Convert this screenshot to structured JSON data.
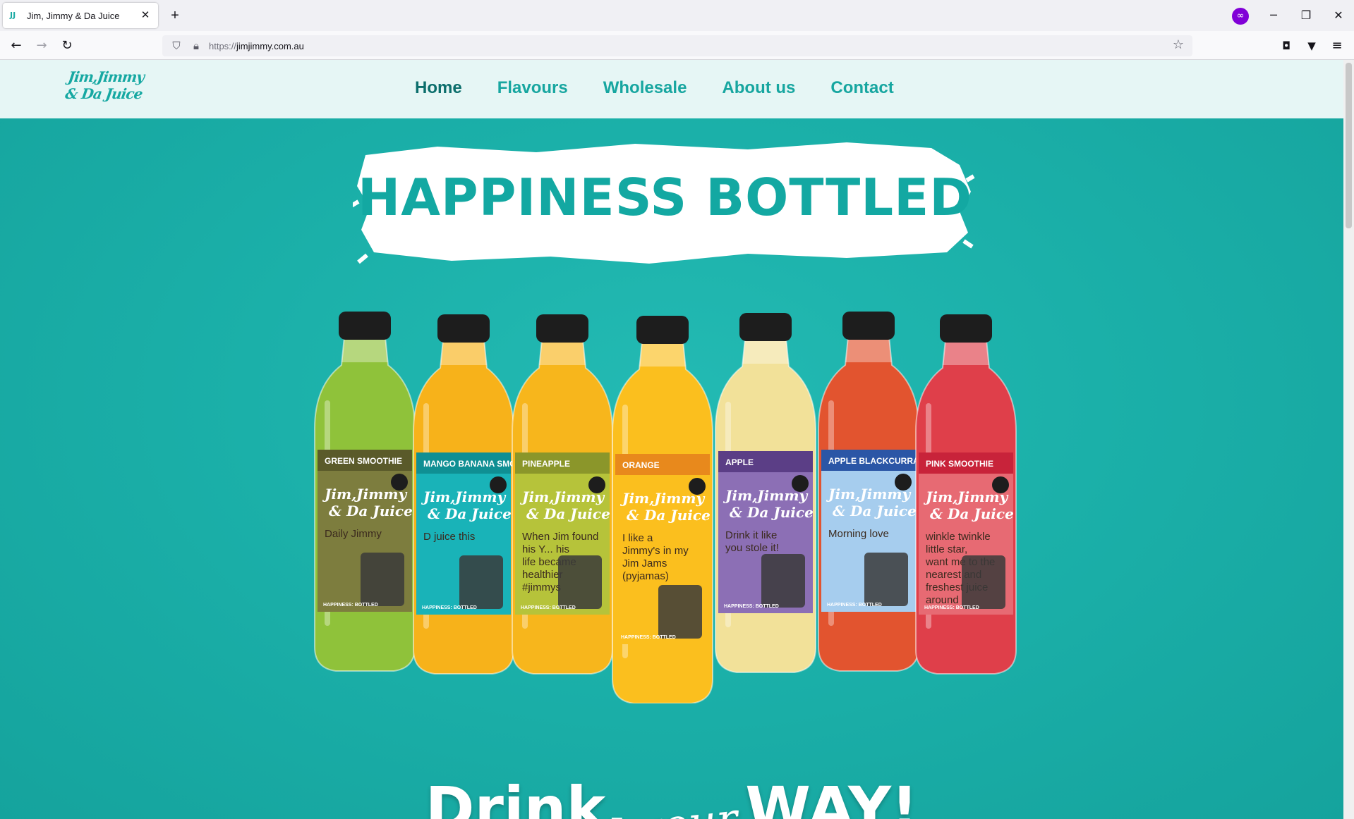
{
  "browser": {
    "tab_title": "Jim, Jimmy & Da Juice",
    "tab_favicon": "juice-favicon",
    "new_tab_label": "+",
    "url_protocol": "https://",
    "url_host": "jimjimmy.com.au"
  },
  "site": {
    "logo_line1": "Jim,Jimmy",
    "logo_line2": "& Da Juice",
    "nav": [
      {
        "label": "Home",
        "active": true
      },
      {
        "label": "Flavours",
        "active": false
      },
      {
        "label": "Wholesale",
        "active": false
      },
      {
        "label": "About us",
        "active": false
      },
      {
        "label": "Contact",
        "active": false
      }
    ]
  },
  "hero": {
    "headline": "HAPPINESS BOTTLED",
    "tagline_part1": "Drink,",
    "tagline_part2": "your",
    "tagline_part3": "WAY!",
    "background_color": "#1bb0a9",
    "bottles": [
      {
        "flavour": "GREEN SMOOTHIE",
        "quote": "Daily Jimmy",
        "juice": "#8fc23a",
        "label": "#7d7d3e",
        "band": "#5a5a2a"
      },
      {
        "flavour": "MANGO BANANA SMOOTHIE",
        "quote": "D juice this",
        "juice": "#f7b21a",
        "label": "#19b3b8",
        "band": "#0f8f93"
      },
      {
        "flavour": "PINEAPPLE",
        "quote": "When Jim found his Y... his life became healthier #jimmys",
        "juice": "#f7b61c",
        "label": "#b6c33a",
        "band": "#8b962a"
      },
      {
        "flavour": "ORANGE",
        "quote": "I like a Jimmy's in my Jim Jams (pyjamas)",
        "juice": "#fbbf1e",
        "label": "#fbbf1e",
        "band": "#e8891c"
      },
      {
        "flavour": "APPLE",
        "quote": "Drink it like you stole it!",
        "juice": "#f2e199",
        "label": "#8c6fb5",
        "band": "#5b3e86"
      },
      {
        "flavour": "APPLE BLACKCURRANT",
        "quote": "Morning love",
        "juice": "#e2542f",
        "label": "#a6cdee",
        "band": "#2b56a6"
      },
      {
        "flavour": "PINK SMOOTHIE",
        "quote": "winkle twinkle little star, want me to the nearest and freshest juice around",
        "juice": "#df3f4a",
        "label": "#e76a73",
        "band": "#c8233a"
      }
    ],
    "bottle_tagline": "HAPPINESS: BOTTLED"
  }
}
